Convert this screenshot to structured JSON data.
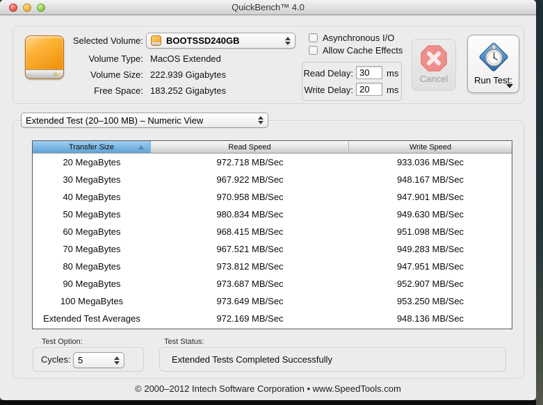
{
  "window": {
    "title": "QuickBench™ 4.0"
  },
  "volume_panel": {
    "selected_volume_label": "Selected Volume:",
    "selected_volume_value": "BOOTSSD240GB",
    "volume_type_label": "Volume Type:",
    "volume_type_value": "MacOS Extended",
    "volume_size_label": "Volume Size:",
    "volume_size_value": "222.939 Gigabytes",
    "free_space_label": "Free Space:",
    "free_space_value": "183.252 Gigabytes"
  },
  "options": {
    "async_io_label": "Asynchronous I/O",
    "async_io_checked": false,
    "allow_cache_label": "Allow Cache Effects",
    "allow_cache_checked": false,
    "read_delay_label": "Read Delay:",
    "read_delay_value": "30",
    "write_delay_label": "Write Delay:",
    "write_delay_value": "20",
    "delay_unit_ms": "ms"
  },
  "actions": {
    "cancel_label": "Cancel",
    "run_test_label": "Run Test:"
  },
  "test_selector": {
    "value": "Extended Test (20–100 MB) – Numeric View"
  },
  "table": {
    "columns": [
      "Transfer Size",
      "Read Speed",
      "Write Speed"
    ],
    "sorted_column": "Transfer Size",
    "sort_direction": "ascending",
    "rows": [
      [
        "20 MegaBytes",
        "972.718 MB/Sec",
        "933.036 MB/Sec"
      ],
      [
        "30 MegaBytes",
        "967.922 MB/Sec",
        "948.167 MB/Sec"
      ],
      [
        "40 MegaBytes",
        "970.958 MB/Sec",
        "947.901 MB/Sec"
      ],
      [
        "50 MegaBytes",
        "980.834 MB/Sec",
        "949.630 MB/Sec"
      ],
      [
        "60 MegaBytes",
        "968.415 MB/Sec",
        "951.098 MB/Sec"
      ],
      [
        "70 MegaBytes",
        "967.521 MB/Sec",
        "949.283 MB/Sec"
      ],
      [
        "80 MegaBytes",
        "973.812 MB/Sec",
        "947.951 MB/Sec"
      ],
      [
        "90 MegaBytes",
        "973.687 MB/Sec",
        "952.907 MB/Sec"
      ],
      [
        "100 MegaBytes",
        "973.649 MB/Sec",
        "953.250 MB/Sec"
      ],
      [
        "Extended Test Averages",
        "972.169 MB/Sec",
        "948.136 MB/Sec"
      ]
    ]
  },
  "bottom": {
    "test_option_label": "Test Option:",
    "cycles_label": "Cycles:",
    "cycles_value": "5",
    "test_status_label": "Test Status:",
    "test_status_value": "Extended Tests Completed Successfully"
  },
  "footer": {
    "copyright": "© 2000–2012 Intech Software Corporation • www.SpeedTools.com"
  },
  "colors": {
    "window_bg": "#ececec",
    "sorted_header_blue": "#5fa3d7",
    "disk_orange": "#f29914",
    "cancel_pink": "#ef8f8c",
    "run_test_blue": "#3f7fc4"
  }
}
